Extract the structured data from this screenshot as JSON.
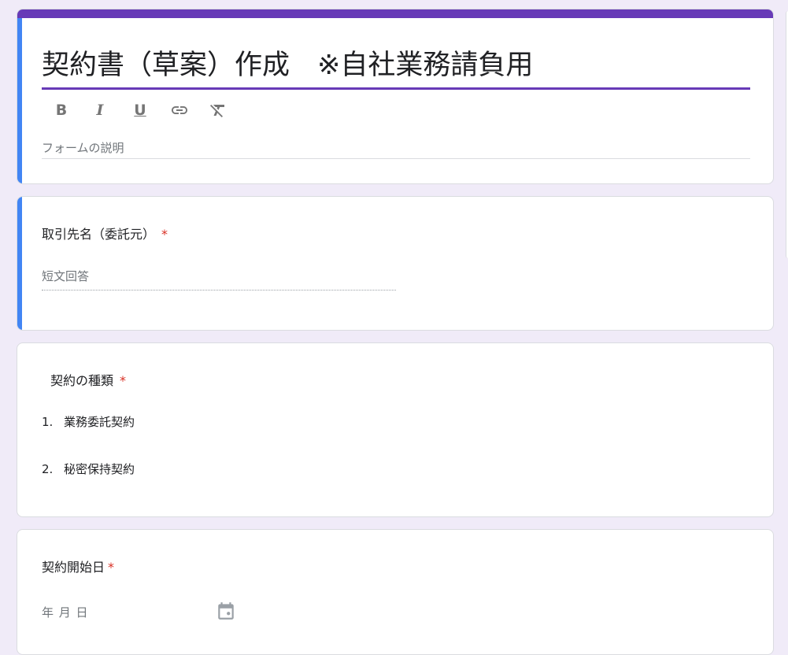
{
  "header": {
    "title": "契約書（草案）作成　※自社業務請負用",
    "description_placeholder": "フォームの説明",
    "toolbar": [
      {
        "name": "bold",
        "glyph": "B"
      },
      {
        "name": "italic",
        "glyph": "I"
      },
      {
        "name": "underline",
        "glyph": "U"
      },
      {
        "name": "link",
        "glyph": "🔗"
      },
      {
        "name": "clear-format",
        "glyph": "T̸"
      }
    ]
  },
  "questions": [
    {
      "title": "取引先名（委託元）",
      "required": "*",
      "placeholder": "短文回答"
    },
    {
      "title": "契約の種類",
      "required": "*",
      "options": [
        {
          "num": "1.",
          "label": "業務委託契約"
        },
        {
          "num": "2.",
          "label": "秘密保持契約"
        }
      ]
    },
    {
      "title": "契約開始日",
      "required": "*",
      "date_placeholder": "年 月 日"
    }
  ],
  "colors": {
    "accent": "#673ab7",
    "active": "#4285f4",
    "background": "#f0ebf8",
    "required": "#d93025"
  }
}
